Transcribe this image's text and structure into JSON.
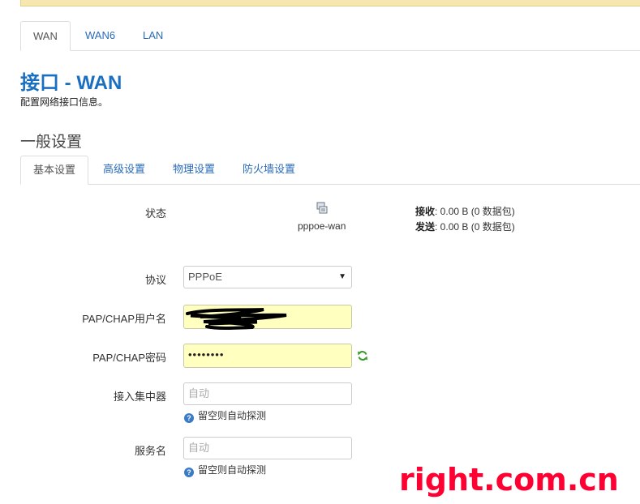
{
  "tabs": [
    {
      "label": "WAN",
      "active": true
    },
    {
      "label": "WAN6",
      "active": false
    },
    {
      "label": "LAN",
      "active": false
    }
  ],
  "page": {
    "title": "接口 - WAN",
    "description": "配置网络接口信息。"
  },
  "section": {
    "title": "一般设置",
    "tabs": [
      {
        "label": "基本设置",
        "active": true
      },
      {
        "label": "高级设置",
        "active": false
      },
      {
        "label": "物理设置",
        "active": false
      },
      {
        "label": "防火墙设置",
        "active": false
      }
    ]
  },
  "status": {
    "label": "状态",
    "interface": "pppoe-wan",
    "rx_label": "接收",
    "rx_value": ": 0.00 B (0 数据包)",
    "tx_label": "发送",
    "tx_value": ": 0.00 B (0 数据包)"
  },
  "form": {
    "protocol": {
      "label": "协议",
      "value": "PPPoE"
    },
    "username": {
      "label": "PAP/CHAP用户名",
      "value": ""
    },
    "password": {
      "label": "PAP/CHAP密码",
      "value": "••••••••"
    },
    "concentrator": {
      "label": "接入集中器",
      "placeholder": "自动",
      "hint": "留空则自动探测"
    },
    "service": {
      "label": "服务名",
      "placeholder": "自动",
      "hint": "留空则自动探测"
    }
  },
  "watermark": "right.com.cn",
  "colors": {
    "accent": "#1a6fc0",
    "link": "#2a6ab8",
    "field_highlight": "#ffffc0",
    "watermark": "#ff0033"
  }
}
